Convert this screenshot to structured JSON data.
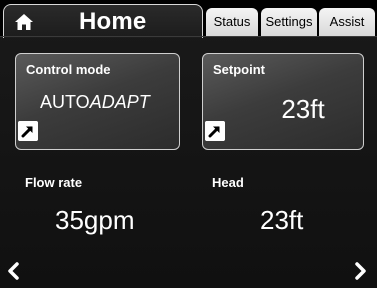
{
  "header": {
    "title": "Home",
    "tabs": [
      {
        "label": "Status"
      },
      {
        "label": "Settings"
      },
      {
        "label": "Assist"
      }
    ]
  },
  "tiles": {
    "control_mode": {
      "label": "Control mode",
      "value_main": "AUTO",
      "value_italic": "ADAPT"
    },
    "setpoint": {
      "label": "Setpoint",
      "value": "23ft"
    }
  },
  "readouts": {
    "flow_rate": {
      "label": "Flow rate",
      "value": "35gpm"
    },
    "head": {
      "label": "Head",
      "value": "23ft"
    }
  },
  "icons": {
    "home": "home-icon",
    "tile_link": "arrow-up-right-icon",
    "nav_prev": "chevron-left-icon",
    "nav_next": "chevron-right-icon"
  },
  "colors": {
    "background": "#141414",
    "tab": "#e6e6e6",
    "tile_border": "#cfcfcf"
  }
}
